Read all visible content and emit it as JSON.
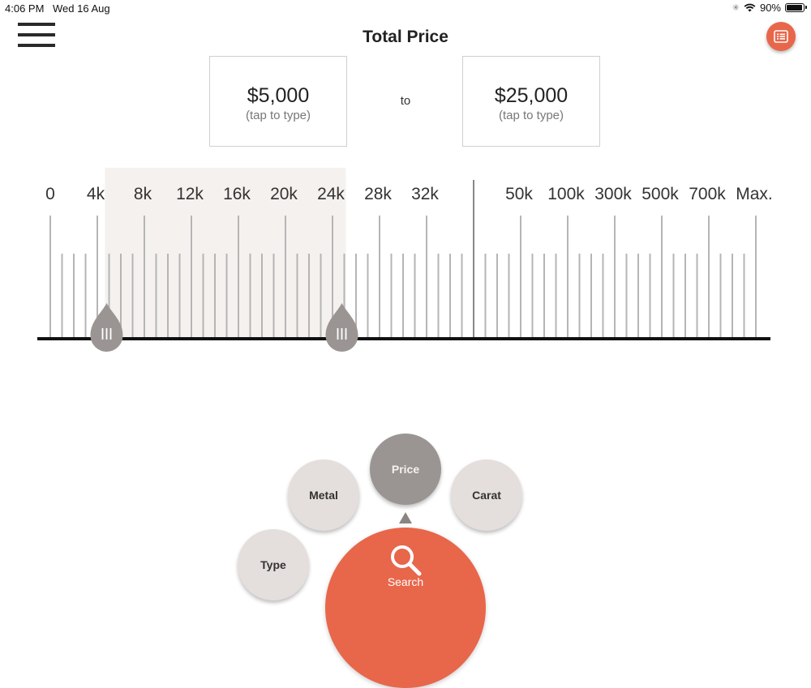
{
  "status": {
    "time": "4:06 PM",
    "date": "Wed 16 Aug",
    "battery": "90%"
  },
  "header": {
    "title": "Total Price",
    "menu_icon": "hamburger-icon",
    "list_icon": "list-icon"
  },
  "price": {
    "min_value": "$5,000",
    "min_hint": "(tap to type)",
    "to_label": "to",
    "max_value": "$25,000",
    "max_hint": "(tap to type)"
  },
  "slider": {
    "tick_labels": [
      "0",
      "4k",
      "8k",
      "12k",
      "16k",
      "20k",
      "24k",
      "28k",
      "32k",
      "50k",
      "100k",
      "300k",
      "500k",
      "700k",
      "Max."
    ],
    "selected_min": 5000,
    "selected_max": 25000,
    "highlight_color": "#f5f1ef"
  },
  "nav": {
    "type_label": "Type",
    "metal_label": "Metal",
    "price_label": "Price",
    "carat_label": "Carat",
    "search_label": "Search",
    "active": "Price"
  },
  "colors": {
    "accent": "#e8664a",
    "active_bubble": "#9a9593",
    "bubble": "#e4dedc"
  }
}
